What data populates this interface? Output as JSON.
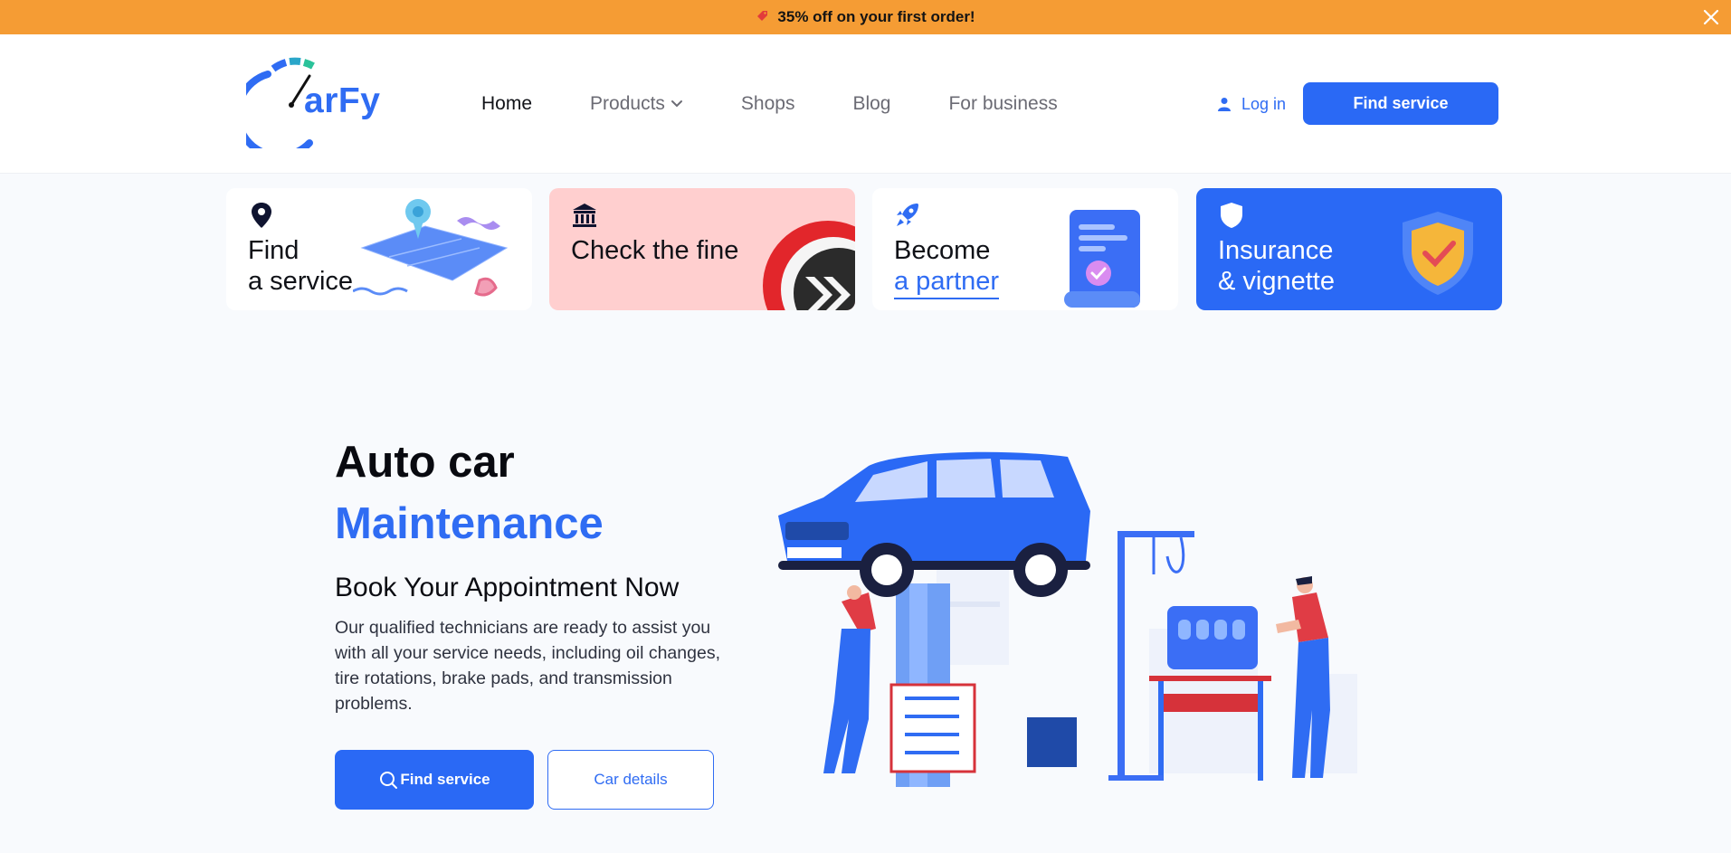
{
  "promo": {
    "text": "35% off on your first order!",
    "tag_icon": "tag-icon",
    "close_icon": "close-icon"
  },
  "header": {
    "logo_text": "arFy",
    "nav": [
      {
        "label": "Home",
        "active": true
      },
      {
        "label": "Products",
        "dropdown": true
      },
      {
        "label": "Shops"
      },
      {
        "label": "Blog"
      },
      {
        "label": "For business"
      }
    ],
    "login_label": "Log in",
    "find_service_label": "Find service"
  },
  "cards": [
    {
      "line1": "Find",
      "line2": "a service",
      "icon": "location-pin-icon"
    },
    {
      "line1": "Check the fine",
      "icon": "bank-icon"
    },
    {
      "line1": "Become",
      "line2": "a partner",
      "icon": "rocket-icon"
    },
    {
      "line1": "Insurance",
      "line2": "& vignette",
      "icon": "shield-icon"
    }
  ],
  "hero": {
    "title_line1": "Auto car",
    "title_line2": "Maintenance",
    "subtitle": "Book Your Appointment Now",
    "description": "Our qualified technicians are ready to assist you with all your service needs, including oil changes, tire rotations, brake pads, and transmission problems.",
    "primary_button": "Find service",
    "secondary_button": "Car details"
  },
  "colors": {
    "accent": "#2a69f5",
    "promo": "#f59c34",
    "fine_card": "#ffcfcf"
  }
}
